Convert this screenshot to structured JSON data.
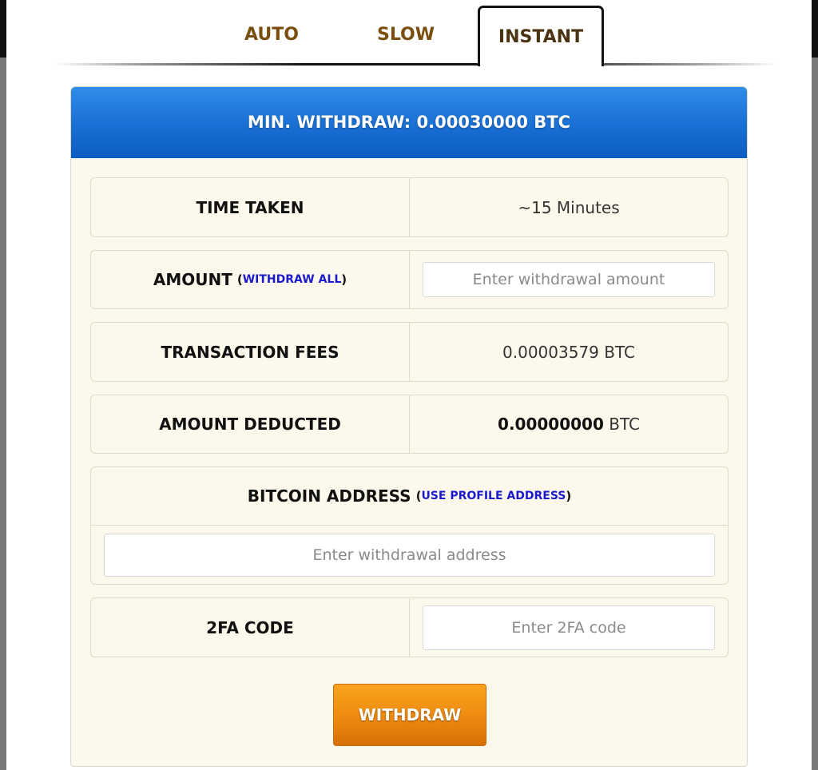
{
  "tabs": [
    {
      "label": "AUTO",
      "active": false
    },
    {
      "label": "SLOW",
      "active": false
    },
    {
      "label": "INSTANT",
      "active": true
    }
  ],
  "panel": {
    "header": "MIN. WITHDRAW: 0.00030000 BTC",
    "time_taken": {
      "label": "TIME TAKEN",
      "value": "~15 Minutes"
    },
    "amount": {
      "label": "AMOUNT",
      "link": "WITHDRAW ALL",
      "paren_open": "(",
      "paren_close": ")",
      "placeholder": "Enter withdrawal amount",
      "value": ""
    },
    "fees": {
      "label": "TRANSACTION FEES",
      "value": "0.00003579 BTC"
    },
    "deducted": {
      "label": "AMOUNT DEDUCTED",
      "amount": "0.00000000",
      "unit": " BTC"
    },
    "address": {
      "label": "BITCOIN ADDRESS",
      "link": "USE PROFILE ADDRESS",
      "paren_open": "(",
      "paren_close": ")",
      "placeholder": "Enter withdrawal address",
      "value": ""
    },
    "twofa": {
      "label": "2FA CODE",
      "placeholder": "Enter 2FA code",
      "value": ""
    },
    "submit_label": "WITHDRAW"
  },
  "colors": {
    "tab_text": "#7a4e0f",
    "header_blue": "#1a6fd4",
    "link_blue": "#1a1acc",
    "button_orange": "#ee8a10",
    "panel_bg": "#fcf9ec"
  }
}
